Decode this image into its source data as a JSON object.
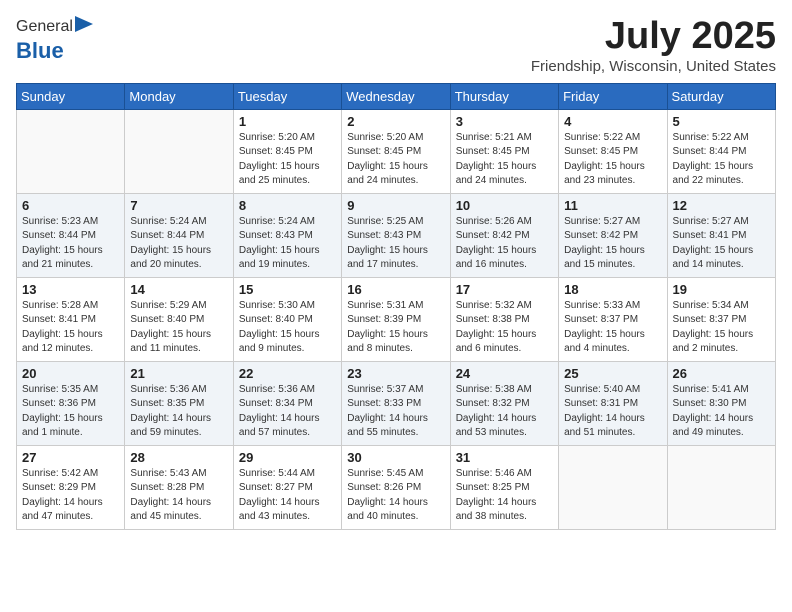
{
  "header": {
    "logo_general": "General",
    "logo_blue": "Blue",
    "month_title": "July 2025",
    "location": "Friendship, Wisconsin, United States"
  },
  "days_of_week": [
    "Sunday",
    "Monday",
    "Tuesday",
    "Wednesday",
    "Thursday",
    "Friday",
    "Saturday"
  ],
  "weeks": [
    [
      {
        "day": "",
        "detail": ""
      },
      {
        "day": "",
        "detail": ""
      },
      {
        "day": "1",
        "detail": "Sunrise: 5:20 AM\nSunset: 8:45 PM\nDaylight: 15 hours\nand 25 minutes."
      },
      {
        "day": "2",
        "detail": "Sunrise: 5:20 AM\nSunset: 8:45 PM\nDaylight: 15 hours\nand 24 minutes."
      },
      {
        "day": "3",
        "detail": "Sunrise: 5:21 AM\nSunset: 8:45 PM\nDaylight: 15 hours\nand 24 minutes."
      },
      {
        "day": "4",
        "detail": "Sunrise: 5:22 AM\nSunset: 8:45 PM\nDaylight: 15 hours\nand 23 minutes."
      },
      {
        "day": "5",
        "detail": "Sunrise: 5:22 AM\nSunset: 8:44 PM\nDaylight: 15 hours\nand 22 minutes."
      }
    ],
    [
      {
        "day": "6",
        "detail": "Sunrise: 5:23 AM\nSunset: 8:44 PM\nDaylight: 15 hours\nand 21 minutes."
      },
      {
        "day": "7",
        "detail": "Sunrise: 5:24 AM\nSunset: 8:44 PM\nDaylight: 15 hours\nand 20 minutes."
      },
      {
        "day": "8",
        "detail": "Sunrise: 5:24 AM\nSunset: 8:43 PM\nDaylight: 15 hours\nand 19 minutes."
      },
      {
        "day": "9",
        "detail": "Sunrise: 5:25 AM\nSunset: 8:43 PM\nDaylight: 15 hours\nand 17 minutes."
      },
      {
        "day": "10",
        "detail": "Sunrise: 5:26 AM\nSunset: 8:42 PM\nDaylight: 15 hours\nand 16 minutes."
      },
      {
        "day": "11",
        "detail": "Sunrise: 5:27 AM\nSunset: 8:42 PM\nDaylight: 15 hours\nand 15 minutes."
      },
      {
        "day": "12",
        "detail": "Sunrise: 5:27 AM\nSunset: 8:41 PM\nDaylight: 15 hours\nand 14 minutes."
      }
    ],
    [
      {
        "day": "13",
        "detail": "Sunrise: 5:28 AM\nSunset: 8:41 PM\nDaylight: 15 hours\nand 12 minutes."
      },
      {
        "day": "14",
        "detail": "Sunrise: 5:29 AM\nSunset: 8:40 PM\nDaylight: 15 hours\nand 11 minutes."
      },
      {
        "day": "15",
        "detail": "Sunrise: 5:30 AM\nSunset: 8:40 PM\nDaylight: 15 hours\nand 9 minutes."
      },
      {
        "day": "16",
        "detail": "Sunrise: 5:31 AM\nSunset: 8:39 PM\nDaylight: 15 hours\nand 8 minutes."
      },
      {
        "day": "17",
        "detail": "Sunrise: 5:32 AM\nSunset: 8:38 PM\nDaylight: 15 hours\nand 6 minutes."
      },
      {
        "day": "18",
        "detail": "Sunrise: 5:33 AM\nSunset: 8:37 PM\nDaylight: 15 hours\nand 4 minutes."
      },
      {
        "day": "19",
        "detail": "Sunrise: 5:34 AM\nSunset: 8:37 PM\nDaylight: 15 hours\nand 2 minutes."
      }
    ],
    [
      {
        "day": "20",
        "detail": "Sunrise: 5:35 AM\nSunset: 8:36 PM\nDaylight: 15 hours\nand 1 minute."
      },
      {
        "day": "21",
        "detail": "Sunrise: 5:36 AM\nSunset: 8:35 PM\nDaylight: 14 hours\nand 59 minutes."
      },
      {
        "day": "22",
        "detail": "Sunrise: 5:36 AM\nSunset: 8:34 PM\nDaylight: 14 hours\nand 57 minutes."
      },
      {
        "day": "23",
        "detail": "Sunrise: 5:37 AM\nSunset: 8:33 PM\nDaylight: 14 hours\nand 55 minutes."
      },
      {
        "day": "24",
        "detail": "Sunrise: 5:38 AM\nSunset: 8:32 PM\nDaylight: 14 hours\nand 53 minutes."
      },
      {
        "day": "25",
        "detail": "Sunrise: 5:40 AM\nSunset: 8:31 PM\nDaylight: 14 hours\nand 51 minutes."
      },
      {
        "day": "26",
        "detail": "Sunrise: 5:41 AM\nSunset: 8:30 PM\nDaylight: 14 hours\nand 49 minutes."
      }
    ],
    [
      {
        "day": "27",
        "detail": "Sunrise: 5:42 AM\nSunset: 8:29 PM\nDaylight: 14 hours\nand 47 minutes."
      },
      {
        "day": "28",
        "detail": "Sunrise: 5:43 AM\nSunset: 8:28 PM\nDaylight: 14 hours\nand 45 minutes."
      },
      {
        "day": "29",
        "detail": "Sunrise: 5:44 AM\nSunset: 8:27 PM\nDaylight: 14 hours\nand 43 minutes."
      },
      {
        "day": "30",
        "detail": "Sunrise: 5:45 AM\nSunset: 8:26 PM\nDaylight: 14 hours\nand 40 minutes."
      },
      {
        "day": "31",
        "detail": "Sunrise: 5:46 AM\nSunset: 8:25 PM\nDaylight: 14 hours\nand 38 minutes."
      },
      {
        "day": "",
        "detail": ""
      },
      {
        "day": "",
        "detail": ""
      }
    ]
  ]
}
